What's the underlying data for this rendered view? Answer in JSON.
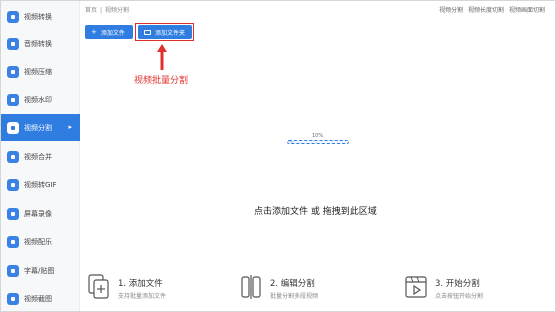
{
  "sidebar": {
    "items": [
      {
        "label": "视频转换",
        "icon": "video-convert-icon",
        "active": false
      },
      {
        "label": "音频转换",
        "icon": "audio-convert-icon",
        "active": false
      },
      {
        "label": "视频压缩",
        "icon": "video-compress-icon",
        "active": false
      },
      {
        "label": "视频水印",
        "icon": "video-watermark-icon",
        "active": false
      },
      {
        "label": "视频分割",
        "icon": "video-split-icon",
        "active": true,
        "arrow": "▸"
      },
      {
        "label": "视频合并",
        "icon": "video-merge-icon",
        "active": false
      },
      {
        "label": "视频转GIF",
        "icon": "video-gif-icon",
        "active": false
      },
      {
        "label": "屏幕录像",
        "icon": "screen-record-icon",
        "active": false
      },
      {
        "label": "视频配乐",
        "icon": "video-music-icon",
        "active": false
      },
      {
        "label": "字幕/贴图",
        "icon": "subtitle-icon",
        "active": false
      },
      {
        "label": "视频截图",
        "icon": "video-screenshot-icon",
        "active": false
      }
    ]
  },
  "header": {
    "breadcrumb": {
      "home": "首页",
      "separator": "|",
      "current": "视频分割"
    },
    "links": [
      "视频分割",
      "视频长度切割",
      "视频画面切割"
    ]
  },
  "toolbar": {
    "add_file_label": "添加文件",
    "add_file_icon": "plus-icon",
    "add_folder_label": "添加文件夹",
    "add_folder_icon": "folder-icon"
  },
  "annotation": {
    "text": "视频批量分割",
    "color": "#e0302b"
  },
  "progress": {
    "label": "10%",
    "value": 0.1
  },
  "dropzone": {
    "hint": "点击添加文件 或 拖拽到此区域"
  },
  "steps": [
    {
      "title": "1. 添加文件",
      "desc": "支持批量添加文件",
      "icon": "add-file-step-icon"
    },
    {
      "title": "2. 编辑分割",
      "desc": "批量分割多段视频",
      "icon": "edit-split-step-icon"
    },
    {
      "title": "3. 开始分割",
      "desc": "点击按钮开始分割",
      "icon": "start-split-step-icon"
    }
  ],
  "colors": {
    "accent": "#2f7de1",
    "highlight": "#e0302b"
  }
}
